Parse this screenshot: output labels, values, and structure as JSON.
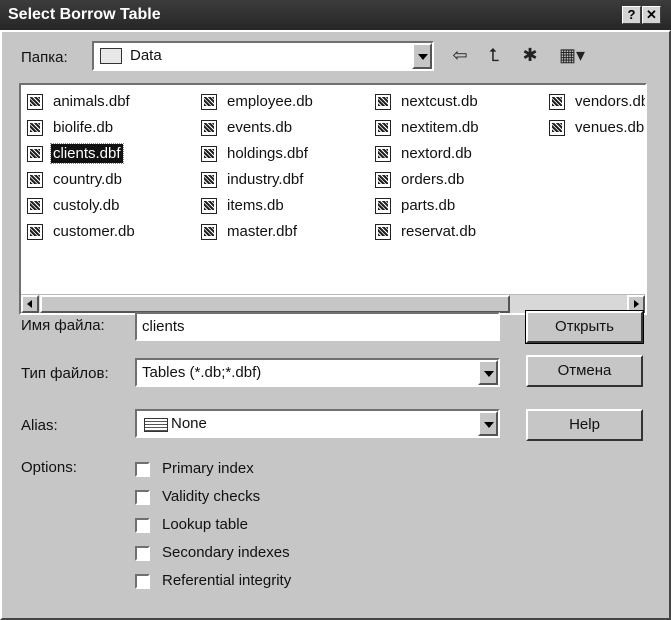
{
  "window": {
    "title": "Select Borrow Table",
    "help_glyph": "?",
    "close_glyph": "✕"
  },
  "lookin": {
    "label": "Папка:",
    "value": "Data"
  },
  "toolbar": {
    "back_icon": "⇦",
    "up_icon": "⮤",
    "newfolder_icon": "✱",
    "view_icon": "▦▾"
  },
  "files": {
    "col1": [
      "animals.dbf",
      "biolife.db",
      "clients.dbf",
      "country.db",
      "custoly.db",
      "customer.db"
    ],
    "col2": [
      "employee.db",
      "events.db",
      "holdings.dbf",
      "industry.dbf",
      "items.db",
      "master.dbf"
    ],
    "col3": [
      "nextcust.db",
      "nextitem.db",
      "nextord.db",
      "orders.db",
      "parts.db",
      "reservat.db"
    ],
    "col4": [
      "vendors.db",
      "venues.db"
    ],
    "selected": "clients.dbf"
  },
  "filename": {
    "label": "Имя файла:",
    "value": "clients"
  },
  "filetype": {
    "label": "Тип файлов:",
    "value": "Tables (*.db;*.dbf)"
  },
  "alias": {
    "label": "Alias:",
    "value": "None"
  },
  "buttons": {
    "open": "Открыть",
    "cancel": "Отмена",
    "help": "Help"
  },
  "options": {
    "label": "Options:",
    "items": [
      "Primary index",
      "Validity checks",
      "Lookup table",
      "Secondary indexes",
      "Referential integrity"
    ]
  }
}
